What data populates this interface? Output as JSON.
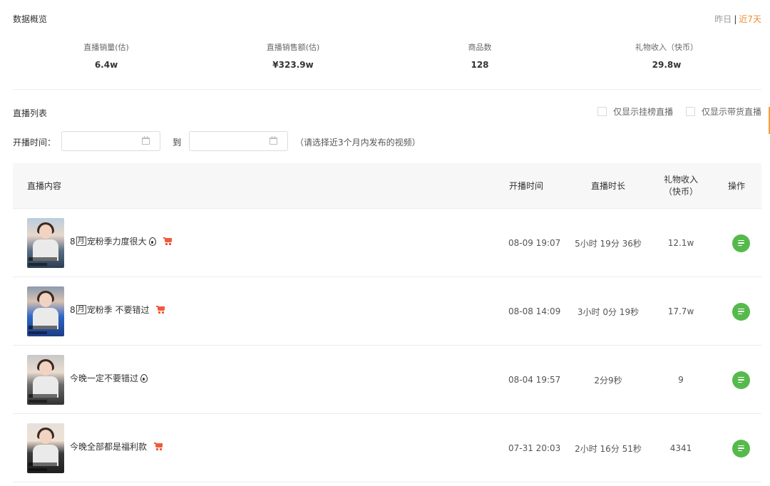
{
  "overview": {
    "title": "数据概览",
    "range": {
      "yesterday": "昨日",
      "separator": "|",
      "last7": "近7天"
    },
    "stats": [
      {
        "label": "直播销量(估)",
        "value": "6.4w"
      },
      {
        "label": "直播销售额(估)",
        "value": "¥323.9w"
      },
      {
        "label": "商品数",
        "value": "128"
      },
      {
        "label": "礼物收入（快币）",
        "value": "29.8w"
      }
    ]
  },
  "live_list": {
    "title": "直播列表",
    "filters": {
      "only_ranked": "仅显示挂榜直播",
      "only_selling": "仅显示带货直播",
      "start_time_label": "开播时间：",
      "to": "到",
      "hint": "（请选择近3个月内发布的视频）",
      "start_date_value": "",
      "end_date_value": ""
    },
    "columns": {
      "content": "直播内容",
      "start": "开播时间",
      "duration": "直播时长",
      "gift": "礼物收入（快币）",
      "op": "操作"
    },
    "rows": [
      {
        "title_pre": "8",
        "title_box": "月",
        "title_post": "宠粉季力度很大",
        "fire": true,
        "cart": true,
        "start": "08-09 19:07",
        "duration": "5小时 19分 36秒",
        "gift": "12.1w"
      },
      {
        "title_pre": "8",
        "title_box": "月",
        "title_post": "宠粉季 不要错过",
        "fire": false,
        "cart": true,
        "start": "08-08 14:09",
        "duration": "3小时 0分 19秒",
        "gift": "17.7w"
      },
      {
        "title_pre": "",
        "title_box": "",
        "title_post": "今晚一定不要错过",
        "fire": true,
        "cart": false,
        "start": "08-04 19:57",
        "duration": "2分9秒",
        "gift": "9"
      },
      {
        "title_pre": "",
        "title_box": "",
        "title_post": "今晚全部都是福利款",
        "fire": false,
        "cart": true,
        "start": "07-31 20:03",
        "duration": "2小时 16分 51秒",
        "gift": "4341"
      }
    ]
  },
  "colors": {
    "accent": "#f08c2e",
    "op_button": "#56b94c",
    "cart": "#f05a3c"
  }
}
